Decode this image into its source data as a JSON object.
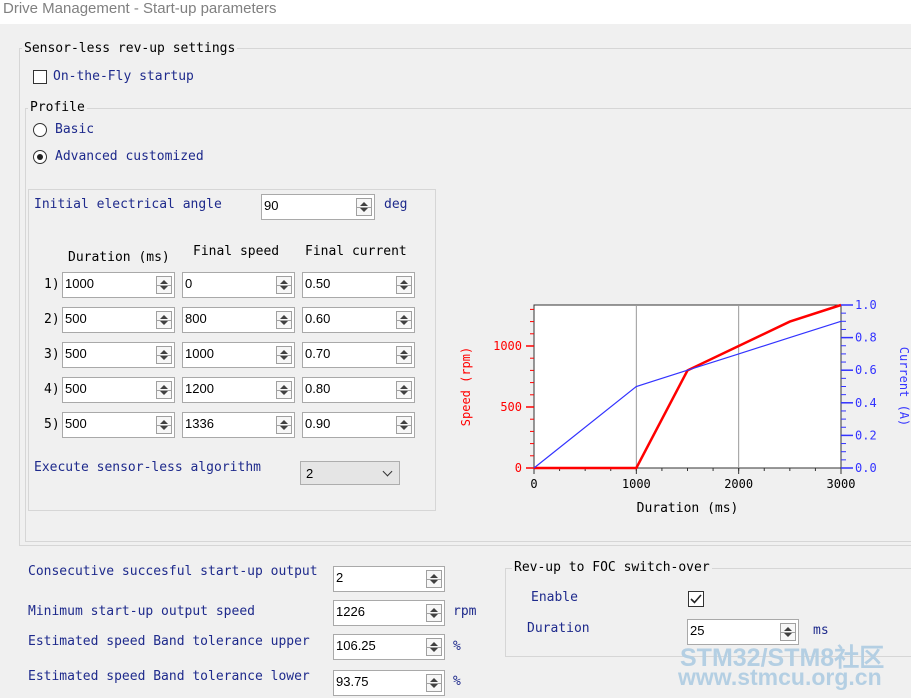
{
  "window": {
    "title": "Drive Management - Start-up parameters"
  },
  "sensorless": {
    "group_title": "Sensor-less rev-up settings",
    "on_the_fly": {
      "label": "On-the-Fly startup",
      "checked": false
    },
    "profile": {
      "title": "Profile",
      "basic_label": "Basic",
      "advanced_label": "Advanced customized",
      "selected": "Advanced customized"
    },
    "initial_angle": {
      "label": "Initial electrical angle",
      "value": "90",
      "unit": "deg"
    },
    "table": {
      "headers": [
        "Duration (ms)",
        "Final speed",
        "Final current"
      ],
      "rows": [
        {
          "idx": "1)",
          "duration": "1000",
          "speed": "0",
          "current": "0.50"
        },
        {
          "idx": "2)",
          "duration": "500",
          "speed": "800",
          "current": "0.60"
        },
        {
          "idx": "3)",
          "duration": "500",
          "speed": "1000",
          "current": "0.70"
        },
        {
          "idx": "4)",
          "duration": "500",
          "speed": "1200",
          "current": "0.80"
        },
        {
          "idx": "5)",
          "duration": "500",
          "speed": "1336",
          "current": "0.90"
        }
      ]
    },
    "execute": {
      "label": "Execute sensor-less algorithm",
      "value": "2"
    }
  },
  "startup": {
    "consecutive": {
      "label": "Consecutive succesful start-up output",
      "value": "2"
    },
    "min_speed": {
      "label": "Minimum start-up output speed",
      "value": "1226",
      "unit": "rpm"
    },
    "band_upper": {
      "label": "Estimated speed Band tolerance upper",
      "value": "106.25",
      "unit": "%"
    },
    "band_lower": {
      "label": "Estimated speed Band tolerance lower",
      "value": "93.75",
      "unit": "%"
    }
  },
  "switchover": {
    "title": "Rev-up to FOC switch-over",
    "enable_label": "Enable",
    "enabled": true,
    "duration_label": "Duration",
    "duration_value": "25",
    "duration_unit": "ms"
  },
  "watermark": {
    "line1": "STM32/STM8社区",
    "line2": "www.stmcu.org.cn"
  },
  "chart_data": {
    "type": "line",
    "xlabel": "Duration (ms)",
    "ylabel_left": "Speed (rpm)",
    "ylabel_right": "Current (A)",
    "xlim": [
      0,
      3000
    ],
    "ylim_left": [
      0,
      1336
    ],
    "ylim_right": [
      0,
      1.0
    ],
    "x_ticks": [
      "0",
      "1000",
      "2000",
      "3000"
    ],
    "y_left_ticks": [
      "0",
      "500",
      "1000"
    ],
    "y_right_ticks": [
      "0.0",
      "0.2",
      "0.4",
      "0.6",
      "0.8",
      "1.0"
    ],
    "grid": "vertical",
    "colors": {
      "speed": "#ff0000",
      "current": "#3333ff"
    },
    "series": [
      {
        "name": "Speed (rpm)",
        "axis": "left",
        "x": [
          0,
          1000,
          1500,
          2000,
          2500,
          3000
        ],
        "y": [
          0,
          0,
          800,
          1000,
          1200,
          1336
        ]
      },
      {
        "name": "Current (A)",
        "axis": "right",
        "x": [
          0,
          1000,
          1500,
          2000,
          2500,
          3000
        ],
        "y": [
          0,
          0.5,
          0.6,
          0.7,
          0.8,
          0.9
        ]
      }
    ]
  }
}
